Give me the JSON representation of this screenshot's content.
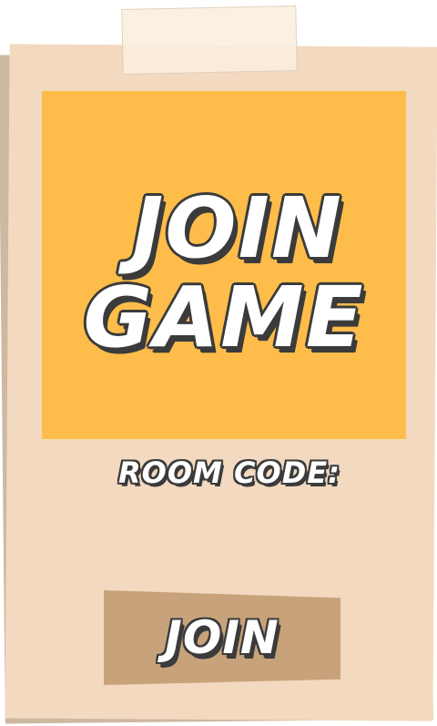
{
  "title": {
    "line1": "JOIN",
    "line2": "GAME"
  },
  "room_code": {
    "label": "ROOM CODE:",
    "value": ""
  },
  "join_button": {
    "label": "JOIN"
  },
  "colors": {
    "card": "#f2d9bf",
    "title_panel": "#febd4a",
    "join_button": "#c8a27a",
    "outline": "#3b3b3b",
    "text": "#ffffff"
  }
}
